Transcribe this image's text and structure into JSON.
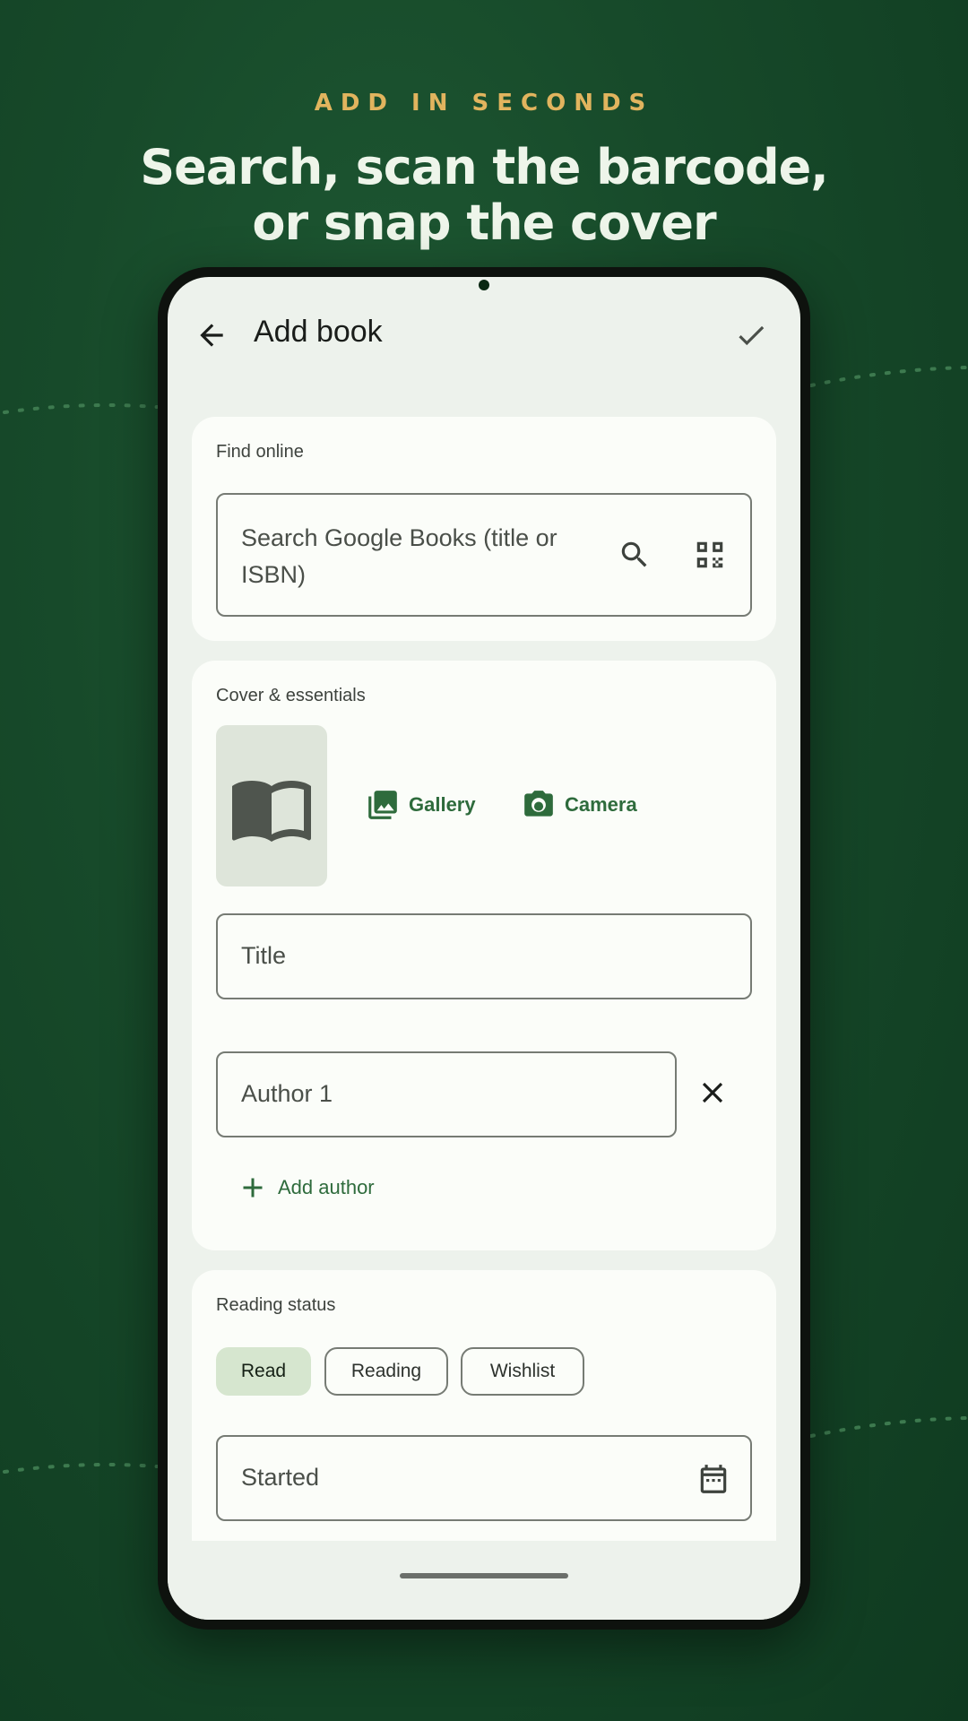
{
  "promo": {
    "eyebrow": "ADD IN SECONDS",
    "headline_line1": "Search, scan the barcode,",
    "headline_line2": "or snap the cover"
  },
  "appbar": {
    "title": "Add book",
    "back_icon": "arrow-back-icon",
    "confirm_icon": "check-icon"
  },
  "find_online": {
    "label": "Find online",
    "search_placeholder_line1": "Search Google Books (title or",
    "search_placeholder_line2": "ISBN)"
  },
  "cover": {
    "label": "Cover & essentials",
    "gallery_label": "Gallery",
    "camera_label": "Camera",
    "title_placeholder": "Title",
    "author_placeholder": "Author 1",
    "add_author_label": "Add author"
  },
  "reading_status": {
    "label": "Reading status",
    "chips": [
      "Read",
      "Reading",
      "Wishlist"
    ],
    "selected": "Read",
    "started_placeholder": "Started"
  },
  "colors": {
    "background": "#174a2a",
    "accent": "#e1b45e",
    "primary": "#2e6b3c",
    "chip_selected": "#d6e6cf"
  }
}
